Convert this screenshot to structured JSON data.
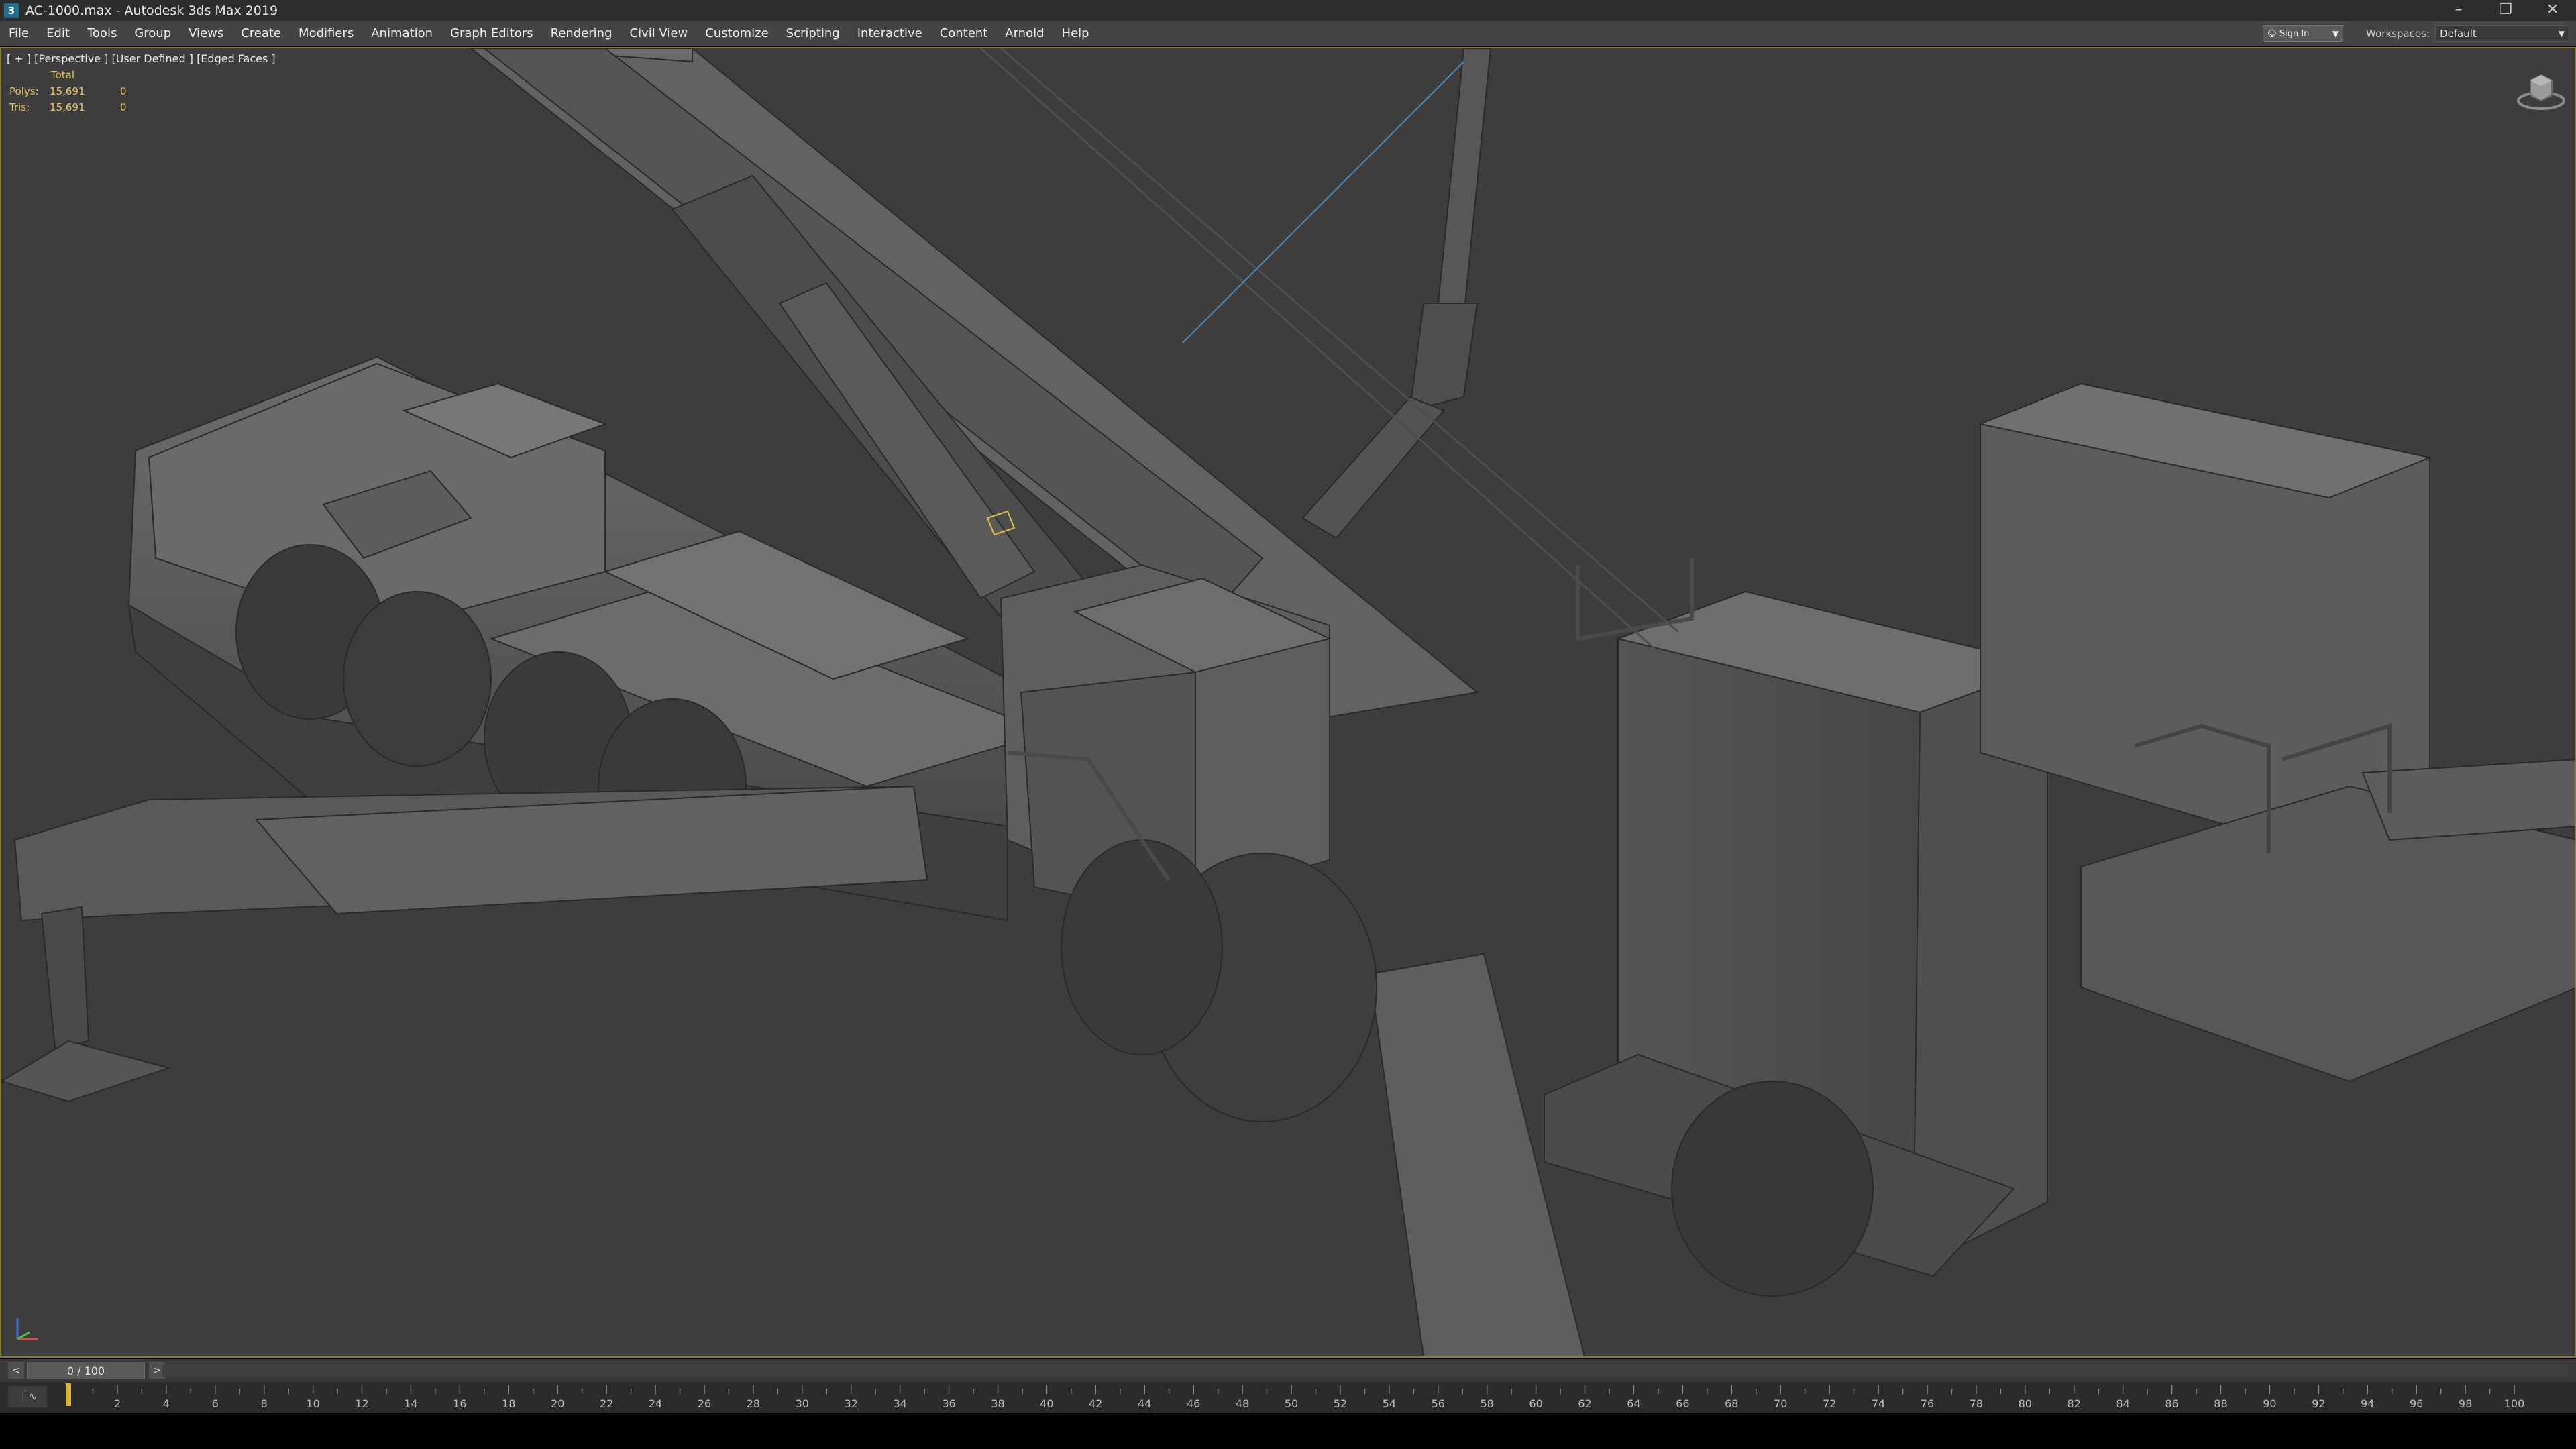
{
  "window": {
    "title": "AC-1000.max - Autodesk 3ds Max 2019",
    "app_icon": "3",
    "controls": [
      "–",
      "❐",
      "✕"
    ]
  },
  "menu": {
    "items": [
      "File",
      "Edit",
      "Tools",
      "Group",
      "Views",
      "Create",
      "Modifiers",
      "Animation",
      "Graph Editors",
      "Rendering",
      "Civil View",
      "Customize",
      "Scripting",
      "Interactive",
      "Content",
      "Arnold",
      "Help"
    ],
    "sign_in": "Sign In",
    "workspaces_label": "Workspaces:",
    "workspace_value": "Default"
  },
  "viewport": {
    "label": "[ + ] [Perspective ] [User Defined ] [Edged Faces ]",
    "stats": {
      "header": "Total",
      "polys_label": "Polys:",
      "polys_total": "15,691",
      "polys_sel": "0",
      "tris_label": "Tris:",
      "tris_total": "15,691",
      "tris_sel": "0"
    },
    "icons": [
      "viewcube-icon",
      "axis-tripod-icon"
    ],
    "colors": {
      "background": "#3d3d3d",
      "active_border": "#8a7a35",
      "stats_text": "#e4c15a"
    }
  },
  "timeslider": {
    "prev": "<",
    "position": "0 / 100",
    "next": ">"
  },
  "trackbar": {
    "curve_button": "⎾∿",
    "frames": [
      0,
      100
    ],
    "ticks": [
      "2",
      "4",
      "6",
      "8",
      "10",
      "12",
      "14",
      "16",
      "18",
      "20",
      "22",
      "24",
      "26",
      "28",
      "30",
      "32",
      "34",
      "36",
      "38",
      "40",
      "42",
      "44",
      "46",
      "48",
      "50",
      "52",
      "54",
      "56",
      "58",
      "60",
      "62",
      "64",
      "66",
      "68",
      "70",
      "72",
      "74",
      "76",
      "78",
      "80",
      "82",
      "84",
      "86",
      "88",
      "90",
      "92",
      "94",
      "96",
      "98",
      "100"
    ]
  }
}
